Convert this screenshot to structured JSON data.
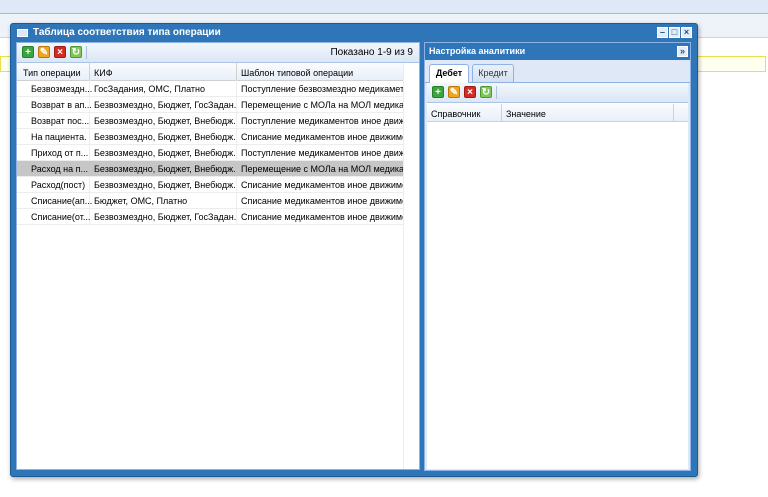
{
  "window": {
    "title": "Таблица соответствия типа операции"
  },
  "left_grid": {
    "paging_text": "Показано 1-9 из 9",
    "columns": [
      "Тип операции",
      "КИФ",
      "Шаблон типовой операции"
    ],
    "rows": [
      [
        "Безвозмездн...",
        "ГосЗадания, ОМС, Платно",
        "Поступление безвозмездно медикамето..."
      ],
      [
        "Возврат в ап...",
        "Безвозмездно, Бюджет, ГосЗадан...",
        "Перемещение с МОЛа на МОЛ медикам..."
      ],
      [
        "Возврат пос...",
        "Безвозмездно, Бюджет, Внебюдж...",
        "Поступление медикаментов иное движ..."
      ],
      [
        "На пациента.",
        "Безвозмездно, Бюджет, Внебюдж...",
        "Списание медикаментов иное движимо..."
      ],
      [
        "Приход от п...",
        "Безвозмездно, Бюджет, Внебюдж...",
        "Поступление медикаментов иное движ..."
      ],
      [
        "Расход на п...",
        "Безвозмездно, Бюджет, Внебюдж...",
        "Перемещение с МОЛа на МОЛ медикам..."
      ],
      [
        "Расход(пост)",
        "Безвозмездно, Бюджет, Внебюдж...",
        "Списание медикаментов иное движимо..."
      ],
      [
        "Списание(ап...",
        "Бюджет, ОМС, Платно",
        "Списание медикаментов иное движимо..."
      ],
      [
        "Списание(от...",
        "Безвозмездно, Бюджет, ГосЗадан...",
        "Списание медикаментов иное движимо..."
      ]
    ],
    "selected_row": 5
  },
  "analytics": {
    "title": "Настройка аналитики",
    "tabs": [
      "Дебет",
      "Кредит"
    ],
    "active_tab": 0,
    "columns": [
      "Справочник",
      "Значение"
    ]
  },
  "icons": {
    "add": "plus-icon",
    "edit": "pencil-icon",
    "delete": "delete-icon",
    "refresh": "refresh-icon",
    "window_minimize": "minimize-icon",
    "window_maximize": "maximize-icon",
    "window_close": "close-icon",
    "collapse": "double-chevron-right-icon"
  },
  "colors": {
    "header_blue": "#2f76b8",
    "selected_row": "#c6c6c6"
  }
}
